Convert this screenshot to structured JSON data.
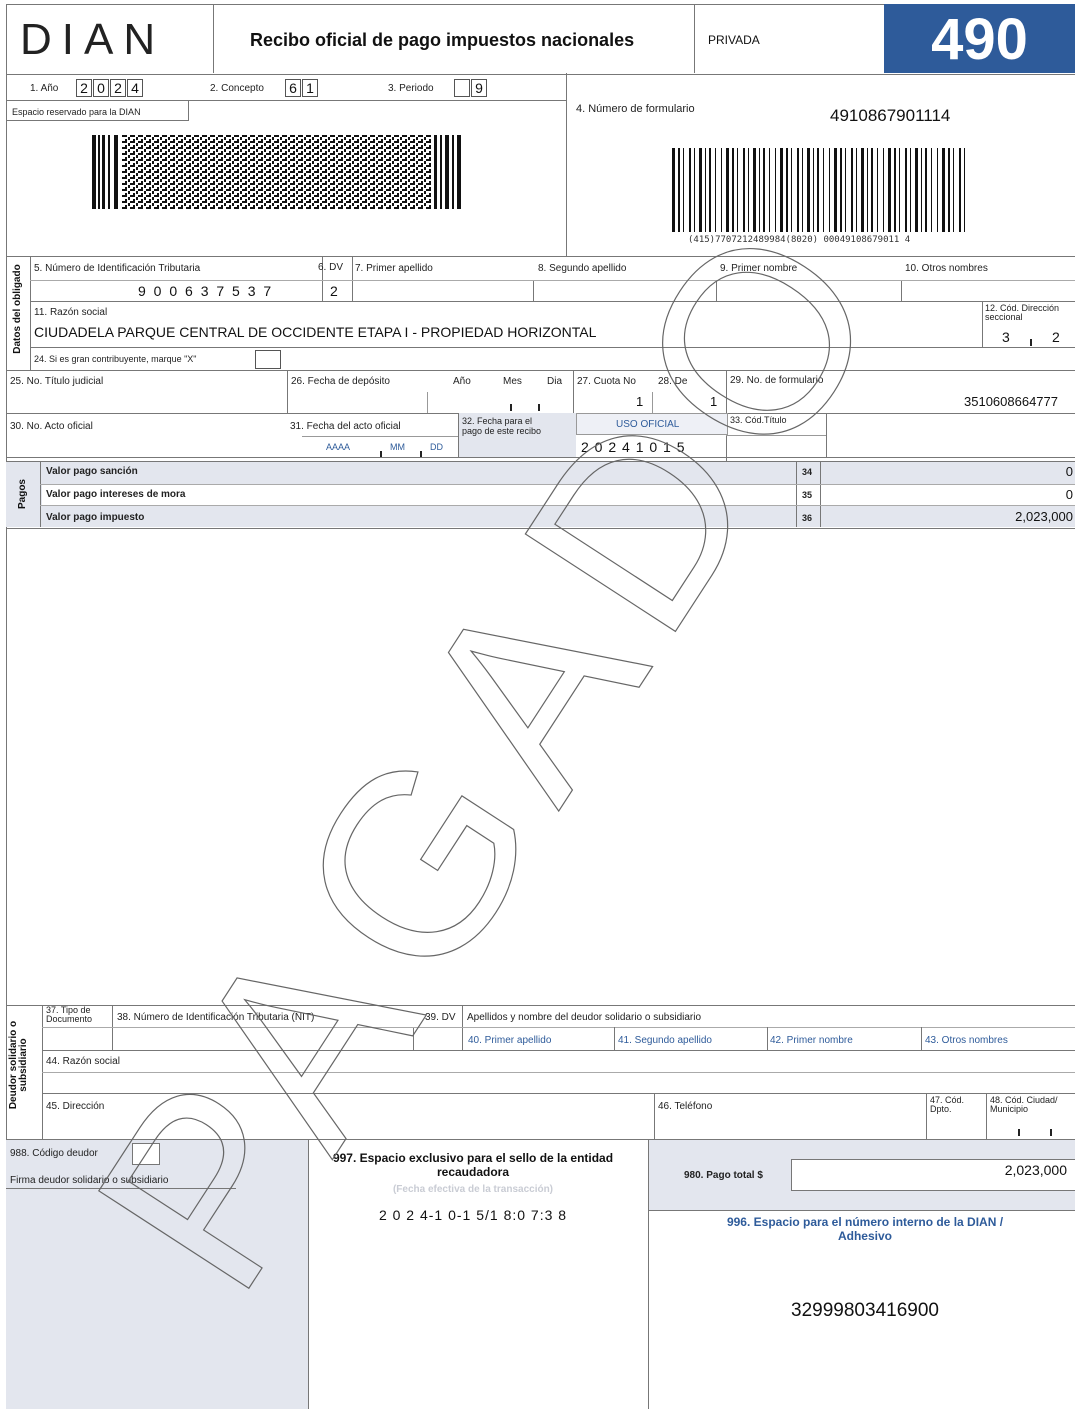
{
  "header": {
    "logo": "DIAN",
    "title": "Recibo oficial de pago impuestos nacionales",
    "privada": "PRIVADA",
    "form_code": "490"
  },
  "row1": {
    "anio_label": "1. Año",
    "anio_digits": [
      "2",
      "0",
      "2",
      "4"
    ],
    "concepto_label": "2. Concepto",
    "concepto_digits": [
      "6",
      "1"
    ],
    "periodo_label": "3. Periodo",
    "periodo_digits": [
      "",
      "9"
    ],
    "reservado_label": "Espacio reservado para la DIAN",
    "num_formulario_label": "4. Número de formulario",
    "num_formulario": "4910867901114",
    "barcode_text": "(415)7707212489984(8020) 00049108679011 4"
  },
  "obligado": {
    "section_label": "Datos del obligado",
    "nit_label": "5. Número de Identificación Tributaria",
    "nit": "9 0 0 6 3 7 5 3 7",
    "dv_label": "6. DV",
    "dv": "2",
    "primer_apellido_label": "7. Primer apellido",
    "segundo_apellido_label": "8. Segundo apellido",
    "primer_nombre_label": "9. Primer nombre",
    "otros_nombres_label": "10. Otros nombres",
    "razon_social_label": "11. Razón social",
    "razon_social": "CIUDADELA PARQUE  CENTRAL DE OCCIDENTE ETAPA I - PROPIEDAD HORIZONTAL",
    "cod_direccion_label": "12. Cód. Dirección seccional",
    "cod_direccion": [
      "3",
      "2"
    ],
    "gran_contribuyente_label": "24. Si es gran contribuyente, marque \"X\""
  },
  "titulo": {
    "titulo_judicial_label": "25. No. Título judicial",
    "fecha_deposito_label": "26. Fecha de depósito",
    "anio": "Año",
    "mes": "Mes",
    "dia": "Dia",
    "cuota_label": "27. Cuota No",
    "cuota": "1",
    "de_label": "28. De",
    "de": "1",
    "no_formulario_label": "29. No. de formulario",
    "no_formulario": "3510608664777",
    "acto_oficial_label": "30. No. Acto oficial",
    "fecha_acto_label": "31. Fecha del acto oficial",
    "aaaa": "AAAA",
    "mm": "MM",
    "dd": "DD",
    "fecha_pago_label": "32. Fecha para el pago de este recibo",
    "uso_oficial": "USO OFICIAL",
    "fecha_pago": "2 0 2 4 1 0 1 5",
    "cod_titulo_label": "33. Cód.Título"
  },
  "pagos": {
    "section_label": "Pagos",
    "rows": [
      {
        "label": "Valor pago sanción",
        "num": "34",
        "value": "0"
      },
      {
        "label": "Valor pago intereses de mora",
        "num": "35",
        "value": "0"
      },
      {
        "label": "Valor pago impuesto",
        "num": "36",
        "value": "2,023,000"
      }
    ]
  },
  "deudor": {
    "section_label": "Deudor solidario o subsidiario",
    "tipo_doc_label": "37. Tipo de Documento",
    "nit_label": "38. Número de Identificación Tributaria (NIT)",
    "dv_label": "39. DV",
    "apellidos_label": "Apellidos y nombre del deudor solidario o subsidiario",
    "primer_apellido_label": "40. Primer apellido",
    "segundo_apellido_label": "41. Segundo apellido",
    "primer_nombre_label": "42. Primer nombre",
    "otros_nombres_label": "43. Otros nombres",
    "razon_social_label": "44. Razón social",
    "direccion_label": "45. Dirección",
    "telefono_label": "46. Teléfono",
    "cod_dpto_label": "47. Cód. Dpto.",
    "cod_ciudad_label": "48. Cód. Ciudad/ Municipio"
  },
  "bottom": {
    "codigo_deudor_label": "988. Código deudor",
    "firma_label": "Firma deudor solidario o subsidiario",
    "sello_title": "997. Espacio exclusivo para el sello de la entidad recaudadora",
    "sello_sub": "(Fecha efectiva de la transacción)",
    "sello_fecha": "2 0 2 4-1 0-1 5/1 8:0 7:3 8",
    "pago_total_label": "980. Pago total  $",
    "pago_total": "2,023,000",
    "interno_label": "996. Espacio para el número interno de la DIAN / Adhesivo",
    "interno": "32999803416900"
  },
  "stamp": "PAGADO",
  "colors": {
    "form_code_bg": "#2e5b9a",
    "accent_blue": "#2e5b9a",
    "gray_panel": "#e3e6ee"
  }
}
